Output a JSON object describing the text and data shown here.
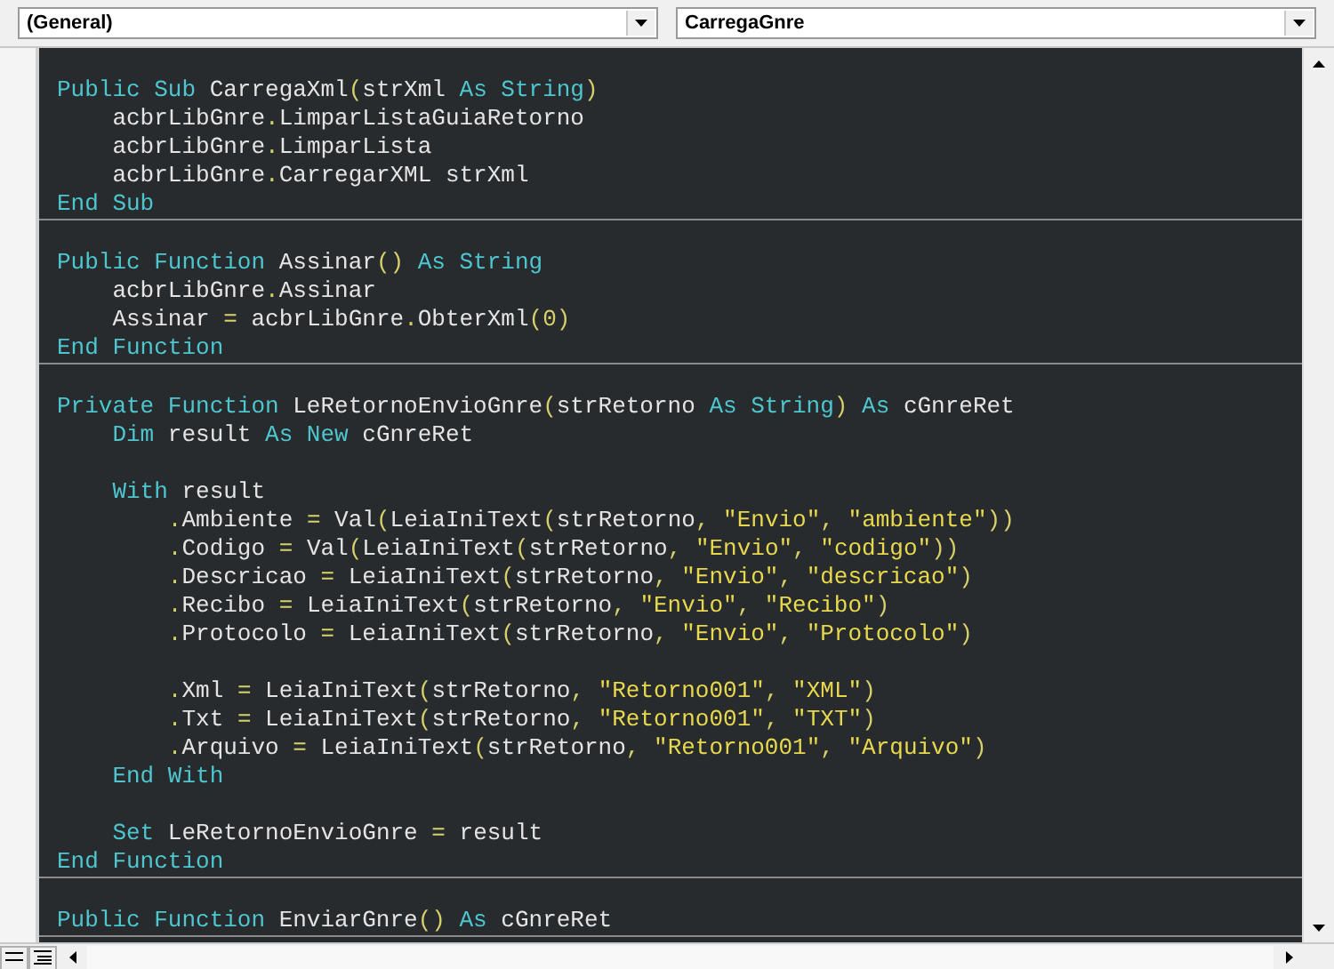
{
  "object_combo": {
    "value": "(General)"
  },
  "procedure_combo": {
    "value": "CarregaGnre"
  },
  "procedures": [
    {
      "lines": [
        {
          "kind": "code",
          "tokens": [
            {
              "kind": "kw",
              "text": "Public Sub "
            },
            {
              "kind": "plain",
              "text": "CarregaXml"
            },
            {
              "kind": "sym",
              "text": "("
            },
            {
              "kind": "plain",
              "text": "strXml "
            },
            {
              "kind": "kw",
              "text": "As String"
            },
            {
              "kind": "sym",
              "text": ")"
            }
          ]
        },
        {
          "kind": "code",
          "tokens": [
            {
              "kind": "plain",
              "text": "    acbrLibGnre"
            },
            {
              "kind": "sym",
              "text": "."
            },
            {
              "kind": "plain",
              "text": "LimparListaGuiaRetorno"
            }
          ]
        },
        {
          "kind": "code",
          "tokens": [
            {
              "kind": "plain",
              "text": "    acbrLibGnre"
            },
            {
              "kind": "sym",
              "text": "."
            },
            {
              "kind": "plain",
              "text": "LimparLista"
            }
          ]
        },
        {
          "kind": "code",
          "tokens": [
            {
              "kind": "plain",
              "text": "    acbrLibGnre"
            },
            {
              "kind": "sym",
              "text": "."
            },
            {
              "kind": "plain",
              "text": "CarregarXML strXml"
            }
          ]
        },
        {
          "kind": "code",
          "tokens": [
            {
              "kind": "kw",
              "text": "End Sub"
            }
          ]
        }
      ]
    },
    {
      "lines": [
        {
          "kind": "code",
          "tokens": [
            {
              "kind": "kw",
              "text": "Public Function "
            },
            {
              "kind": "plain",
              "text": "Assinar"
            },
            {
              "kind": "sym",
              "text": "()"
            },
            {
              "kind": "kw",
              "text": " As String"
            }
          ]
        },
        {
          "kind": "code",
          "tokens": [
            {
              "kind": "plain",
              "text": "    acbrLibGnre"
            },
            {
              "kind": "sym",
              "text": "."
            },
            {
              "kind": "plain",
              "text": "Assinar"
            }
          ]
        },
        {
          "kind": "code",
          "tokens": [
            {
              "kind": "plain",
              "text": "    Assinar "
            },
            {
              "kind": "sym",
              "text": "="
            },
            {
              "kind": "plain",
              "text": " acbrLibGnre"
            },
            {
              "kind": "sym",
              "text": "."
            },
            {
              "kind": "plain",
              "text": "ObterXml"
            },
            {
              "kind": "sym",
              "text": "(0)"
            }
          ]
        },
        {
          "kind": "code",
          "tokens": [
            {
              "kind": "kw",
              "text": "End Function"
            }
          ]
        }
      ]
    },
    {
      "lines": [
        {
          "kind": "code",
          "tokens": [
            {
              "kind": "kw",
              "text": "Private Function "
            },
            {
              "kind": "plain",
              "text": "LeRetornoEnvioGnre"
            },
            {
              "kind": "sym",
              "text": "("
            },
            {
              "kind": "plain",
              "text": "strRetorno "
            },
            {
              "kind": "kw",
              "text": "As String"
            },
            {
              "kind": "sym",
              "text": ")"
            },
            {
              "kind": "kw",
              "text": " As "
            },
            {
              "kind": "plain",
              "text": "cGnreRet"
            }
          ]
        },
        {
          "kind": "code",
          "tokens": [
            {
              "kind": "kw",
              "text": "    Dim "
            },
            {
              "kind": "plain",
              "text": "result "
            },
            {
              "kind": "kw",
              "text": "As New "
            },
            {
              "kind": "plain",
              "text": "cGnreRet"
            }
          ]
        },
        {
          "kind": "blank"
        },
        {
          "kind": "code",
          "tokens": [
            {
              "kind": "kw",
              "text": "    With "
            },
            {
              "kind": "plain",
              "text": "result"
            }
          ]
        },
        {
          "kind": "code",
          "tokens": [
            {
              "kind": "sym",
              "text": "        ."
            },
            {
              "kind": "plain",
              "text": "Ambiente "
            },
            {
              "kind": "sym",
              "text": "="
            },
            {
              "kind": "plain",
              "text": " Val"
            },
            {
              "kind": "sym",
              "text": "("
            },
            {
              "kind": "plain",
              "text": "LeiaIniText"
            },
            {
              "kind": "sym",
              "text": "("
            },
            {
              "kind": "plain",
              "text": "strRetorno"
            },
            {
              "kind": "sym",
              "text": ", "
            },
            {
              "kind": "str",
              "text": "\"Envio\""
            },
            {
              "kind": "sym",
              "text": ", "
            },
            {
              "kind": "str",
              "text": "\"ambiente\""
            },
            {
              "kind": "sym",
              "text": "))"
            }
          ]
        },
        {
          "kind": "code",
          "tokens": [
            {
              "kind": "sym",
              "text": "        ."
            },
            {
              "kind": "plain",
              "text": "Codigo "
            },
            {
              "kind": "sym",
              "text": "="
            },
            {
              "kind": "plain",
              "text": " Val"
            },
            {
              "kind": "sym",
              "text": "("
            },
            {
              "kind": "plain",
              "text": "LeiaIniText"
            },
            {
              "kind": "sym",
              "text": "("
            },
            {
              "kind": "plain",
              "text": "strRetorno"
            },
            {
              "kind": "sym",
              "text": ", "
            },
            {
              "kind": "str",
              "text": "\"Envio\""
            },
            {
              "kind": "sym",
              "text": ", "
            },
            {
              "kind": "str",
              "text": "\"codigo\""
            },
            {
              "kind": "sym",
              "text": "))"
            }
          ]
        },
        {
          "kind": "code",
          "tokens": [
            {
              "kind": "sym",
              "text": "        ."
            },
            {
              "kind": "plain",
              "text": "Descricao "
            },
            {
              "kind": "sym",
              "text": "="
            },
            {
              "kind": "plain",
              "text": " LeiaIniText"
            },
            {
              "kind": "sym",
              "text": "("
            },
            {
              "kind": "plain",
              "text": "strRetorno"
            },
            {
              "kind": "sym",
              "text": ", "
            },
            {
              "kind": "str",
              "text": "\"Envio\""
            },
            {
              "kind": "sym",
              "text": ", "
            },
            {
              "kind": "str",
              "text": "\"descricao\""
            },
            {
              "kind": "sym",
              "text": ")"
            }
          ]
        },
        {
          "kind": "code",
          "tokens": [
            {
              "kind": "sym",
              "text": "        ."
            },
            {
              "kind": "plain",
              "text": "Recibo "
            },
            {
              "kind": "sym",
              "text": "="
            },
            {
              "kind": "plain",
              "text": " LeiaIniText"
            },
            {
              "kind": "sym",
              "text": "("
            },
            {
              "kind": "plain",
              "text": "strRetorno"
            },
            {
              "kind": "sym",
              "text": ", "
            },
            {
              "kind": "str",
              "text": "\"Envio\""
            },
            {
              "kind": "sym",
              "text": ", "
            },
            {
              "kind": "str",
              "text": "\"Recibo\""
            },
            {
              "kind": "sym",
              "text": ")"
            }
          ]
        },
        {
          "kind": "code",
          "tokens": [
            {
              "kind": "sym",
              "text": "        ."
            },
            {
              "kind": "plain",
              "text": "Protocolo "
            },
            {
              "kind": "sym",
              "text": "="
            },
            {
              "kind": "plain",
              "text": " LeiaIniText"
            },
            {
              "kind": "sym",
              "text": "("
            },
            {
              "kind": "plain",
              "text": "strRetorno"
            },
            {
              "kind": "sym",
              "text": ", "
            },
            {
              "kind": "str",
              "text": "\"Envio\""
            },
            {
              "kind": "sym",
              "text": ", "
            },
            {
              "kind": "str",
              "text": "\"Protocolo\""
            },
            {
              "kind": "sym",
              "text": ")"
            }
          ]
        },
        {
          "kind": "blank"
        },
        {
          "kind": "code",
          "tokens": [
            {
              "kind": "sym",
              "text": "        ."
            },
            {
              "kind": "plain",
              "text": "Xml "
            },
            {
              "kind": "sym",
              "text": "="
            },
            {
              "kind": "plain",
              "text": " LeiaIniText"
            },
            {
              "kind": "sym",
              "text": "("
            },
            {
              "kind": "plain",
              "text": "strRetorno"
            },
            {
              "kind": "sym",
              "text": ", "
            },
            {
              "kind": "str",
              "text": "\"Retorno001\""
            },
            {
              "kind": "sym",
              "text": ", "
            },
            {
              "kind": "str",
              "text": "\"XML\""
            },
            {
              "kind": "sym",
              "text": ")"
            }
          ]
        },
        {
          "kind": "code",
          "tokens": [
            {
              "kind": "sym",
              "text": "        ."
            },
            {
              "kind": "plain",
              "text": "Txt "
            },
            {
              "kind": "sym",
              "text": "="
            },
            {
              "kind": "plain",
              "text": " LeiaIniText"
            },
            {
              "kind": "sym",
              "text": "("
            },
            {
              "kind": "plain",
              "text": "strRetorno"
            },
            {
              "kind": "sym",
              "text": ", "
            },
            {
              "kind": "str",
              "text": "\"Retorno001\""
            },
            {
              "kind": "sym",
              "text": ", "
            },
            {
              "kind": "str",
              "text": "\"TXT\""
            },
            {
              "kind": "sym",
              "text": ")"
            }
          ]
        },
        {
          "kind": "code",
          "tokens": [
            {
              "kind": "sym",
              "text": "        ."
            },
            {
              "kind": "plain",
              "text": "Arquivo "
            },
            {
              "kind": "sym",
              "text": "="
            },
            {
              "kind": "plain",
              "text": " LeiaIniText"
            },
            {
              "kind": "sym",
              "text": "("
            },
            {
              "kind": "plain",
              "text": "strRetorno"
            },
            {
              "kind": "sym",
              "text": ", "
            },
            {
              "kind": "str",
              "text": "\"Retorno001\""
            },
            {
              "kind": "sym",
              "text": ", "
            },
            {
              "kind": "str",
              "text": "\"Arquivo\""
            },
            {
              "kind": "sym",
              "text": ")"
            }
          ]
        },
        {
          "kind": "code",
          "tokens": [
            {
              "kind": "kw",
              "text": "    End With"
            }
          ]
        },
        {
          "kind": "blank"
        },
        {
          "kind": "code",
          "tokens": [
            {
              "kind": "kw",
              "text": "    Set "
            },
            {
              "kind": "plain",
              "text": "LeRetornoEnvioGnre "
            },
            {
              "kind": "sym",
              "text": "="
            },
            {
              "kind": "plain",
              "text": " result"
            }
          ]
        },
        {
          "kind": "code",
          "tokens": [
            {
              "kind": "kw",
              "text": "End Function"
            }
          ]
        }
      ]
    },
    {
      "lines": [
        {
          "kind": "code",
          "tokens": [
            {
              "kind": "kw",
              "text": "Public Function "
            },
            {
              "kind": "plain",
              "text": "EnviarGnre"
            },
            {
              "kind": "sym",
              "text": "()"
            },
            {
              "kind": "kw",
              "text": " As "
            },
            {
              "kind": "plain",
              "text": "cGnreRet"
            }
          ]
        }
      ]
    }
  ]
}
